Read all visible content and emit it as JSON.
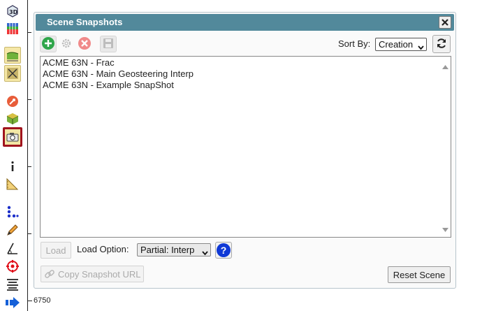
{
  "toolbar": {
    "depth_label": "6750",
    "buttons": [
      {
        "name": "3d-view-icon"
      },
      {
        "name": "layers-grid-icon"
      },
      {
        "name": "surface-icon"
      },
      {
        "name": "fault-icon"
      },
      {
        "name": "compass-icon"
      },
      {
        "name": "cube-icon"
      },
      {
        "name": "camera-icon",
        "selected": true
      },
      {
        "name": "info-icon"
      },
      {
        "name": "ruler-icon"
      },
      {
        "name": "points-icon"
      },
      {
        "name": "pencil-icon"
      },
      {
        "name": "measure-angle-icon"
      },
      {
        "name": "target-icon"
      },
      {
        "name": "align-lines-icon"
      },
      {
        "name": "arrow-right-icon"
      }
    ]
  },
  "dialog": {
    "title": "Scene Snapshots",
    "sort_by_label": "Sort By:",
    "sort_by_value": "Creation",
    "snapshots": [
      "ACME 63N - Frac",
      "ACME 63N - Main Geosteering Interp",
      "ACME 63N - Example SnapShot"
    ],
    "load_label": "Load",
    "load_option_label": "Load Option:",
    "load_option_value": "Partial: Interp",
    "help_label": "?",
    "copy_url_label": "Copy Snapshot URL",
    "reset_label": "Reset Scene"
  },
  "colors": {
    "titlebar": "#52899b",
    "add": "#2fa64a",
    "delete": "#f08a8a",
    "help": "#1039d6",
    "selected_border": "#a0141e"
  }
}
